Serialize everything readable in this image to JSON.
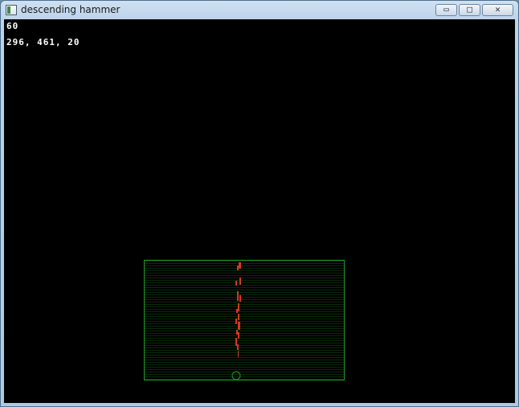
{
  "window": {
    "title": "descending hammer",
    "controls": {
      "minimize": "▭",
      "maximize": "□",
      "close": "✕"
    }
  },
  "hud": {
    "fps": "60",
    "coordinates": "296, 461, 20"
  },
  "colors": {
    "background": "#000000",
    "arena_border": "#1b9a22",
    "particles": "#d03a1e",
    "player_ring": "#1b9a22",
    "hud_text": "#ffffff"
  },
  "icons": [
    "app-window-icon",
    "minimize-icon",
    "maximize-icon",
    "close-icon",
    "player-ring-icon"
  ]
}
